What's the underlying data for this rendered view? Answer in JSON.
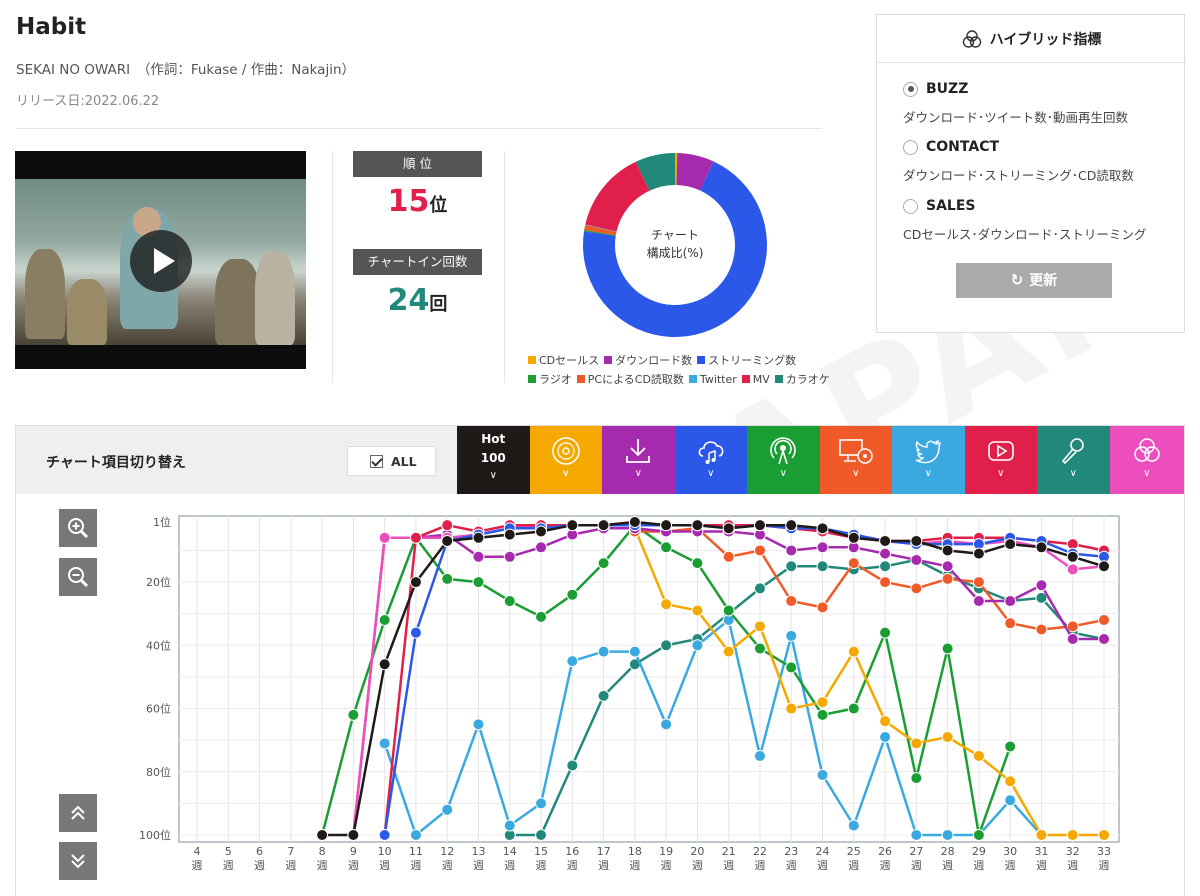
{
  "song": {
    "title": "Habit",
    "credit": "SEKAI NO OWARI　（作詞：Fukase / 作曲：Nakajin）",
    "release": "リリース日:2022.06.22"
  },
  "stats": {
    "rank_label": "順 位",
    "rank_value": "15",
    "rank_unit": "位",
    "chart_in_label": "チャートイン回数",
    "chart_in_value": "24",
    "chart_in_unit": "回"
  },
  "colors": {
    "cd": "#f5a800",
    "download": "#a52aad",
    "streaming": "#2b58e8",
    "radio": "#1a9e33",
    "pc": "#f05a28",
    "twitter": "#3aa9e0",
    "mv": "#e0204a",
    "karaoke": "#22897a",
    "hot100": "#1a1a1a",
    "hybrid": "#ec4fbd"
  },
  "composition": {
    "center_line1": "チャート",
    "center_line2": "構成比(%)",
    "segments": [
      {
        "name": "CDセールス",
        "value": 0.4,
        "color": "#f5a800"
      },
      {
        "name": "ダウンロード数",
        "value": 6.5,
        "color": "#a52aad"
      },
      {
        "name": "ストリーミング数",
        "value": 70.5,
        "color": "#2b58e8"
      },
      {
        "name": "ラジオ",
        "value": 0.2,
        "color": "#1a9e33"
      },
      {
        "name": "PCによるCD読取数",
        "value": 0.9,
        "color": "#f05a28"
      },
      {
        "name": "Twitter",
        "value": 0.1,
        "color": "#3aa9e0"
      },
      {
        "name": "MV",
        "value": 14.4,
        "color": "#e0204a"
      },
      {
        "name": "カラオケ",
        "value": 7.0,
        "color": "#22897a"
      }
    ]
  },
  "hybrid": {
    "title": "ハイブリッド指標",
    "options": [
      {
        "label": "BUZZ",
        "desc": "ダウンロード･ツイート数･動画再生回数",
        "selected": true
      },
      {
        "label": "CONTACT",
        "desc": "ダウンロード･ストリーミング･CD読取数",
        "selected": false
      },
      {
        "label": "SALES",
        "desc": "CDセールス･ダウンロード･ストリーミング",
        "selected": false
      }
    ],
    "update_label": "更新"
  },
  "toolbar": {
    "label": "チャート項目切り替え",
    "all_label": "ALL",
    "hot_line1": "Hot",
    "hot_line2": "100",
    "tabs": [
      {
        "name": "hot100",
        "color": "#1f1a17",
        "icon": "hot100-text"
      },
      {
        "name": "cd",
        "color": "#f5a800",
        "icon": "disc-icon"
      },
      {
        "name": "download",
        "color": "#a52aad",
        "icon": "download-icon"
      },
      {
        "name": "streaming",
        "color": "#2b58e8",
        "icon": "cloud-music-icon"
      },
      {
        "name": "radio",
        "color": "#1a9e33",
        "icon": "radio-icon"
      },
      {
        "name": "pc",
        "color": "#f05a28",
        "icon": "pc-disc-icon"
      },
      {
        "name": "twitter",
        "color": "#3aa9e0",
        "icon": "twitter-icon"
      },
      {
        "name": "mv",
        "color": "#e0204a",
        "icon": "video-icon"
      },
      {
        "name": "karaoke",
        "color": "#22897a",
        "icon": "microphone-icon"
      },
      {
        "name": "hybrid",
        "color": "#ec4fbd",
        "icon": "hybrid-icon"
      }
    ]
  },
  "chart_data": {
    "type": "line",
    "y_inverted": true,
    "ylim": [
      1,
      100
    ],
    "y_ticks": [
      "1位",
      "20位",
      "40位",
      "60位",
      "80位",
      "100位"
    ],
    "y_tick_values": [
      1,
      20,
      40,
      60,
      80,
      100
    ],
    "x": [
      4,
      5,
      6,
      7,
      8,
      9,
      10,
      11,
      12,
      13,
      14,
      15,
      16,
      17,
      18,
      19,
      20,
      21,
      22,
      23,
      24,
      25,
      26,
      27,
      28,
      29,
      30,
      31,
      32,
      33
    ],
    "x_labels_top": [
      "4",
      "5",
      "6",
      "7",
      "8",
      "9",
      "10",
      "11",
      "12",
      "13",
      "14",
      "15",
      "16",
      "17",
      "18",
      "19",
      "20",
      "21",
      "22",
      "23",
      "24",
      "25",
      "26",
      "27",
      "28",
      "29",
      "30",
      "31",
      "32",
      "33"
    ],
    "x_label_unit": "週",
    "grid": true,
    "series": [
      {
        "key": "karaoke",
        "color": "#22897a",
        "values": [
          null,
          null,
          null,
          null,
          null,
          null,
          null,
          null,
          null,
          null,
          100,
          100,
          78,
          56,
          46,
          40,
          38,
          30,
          22,
          15,
          15,
          16,
          15,
          13,
          18,
          22,
          26,
          25,
          36,
          38
        ]
      },
      {
        "key": "twitter",
        "color": "#3aa9e0",
        "values": [
          null,
          null,
          null,
          null,
          null,
          null,
          71,
          100,
          92,
          65,
          97,
          90,
          45,
          42,
          42,
          65,
          40,
          32,
          75,
          37,
          81,
          97,
          69,
          100,
          100,
          100,
          89,
          100,
          null,
          null
        ]
      },
      {
        "key": "radio",
        "color": "#1a9e33",
        "values": [
          null,
          null,
          null,
          null,
          100,
          62,
          32,
          6,
          19,
          20,
          26,
          31,
          24,
          14,
          2,
          9,
          14,
          29,
          41,
          47,
          62,
          60,
          36,
          82,
          41,
          100,
          72,
          null,
          null,
          null
        ]
      },
      {
        "key": "cd",
        "color": "#f5a800",
        "values": [
          null,
          null,
          null,
          null,
          null,
          null,
          null,
          null,
          null,
          null,
          null,
          null,
          null,
          null,
          3,
          27,
          29,
          42,
          34,
          60,
          58,
          42,
          64,
          71,
          69,
          75,
          83,
          100,
          100,
          100
        ]
      },
      {
        "key": "pc",
        "color": "#f05a28",
        "values": [
          null,
          null,
          null,
          null,
          null,
          null,
          null,
          null,
          null,
          null,
          null,
          null,
          null,
          null,
          4,
          4,
          3,
          12,
          10,
          26,
          28,
          14,
          20,
          22,
          19,
          20,
          33,
          35,
          34,
          32
        ]
      },
      {
        "key": "download",
        "color": "#a52aad",
        "values": [
          null,
          null,
          null,
          null,
          null,
          100,
          6,
          6,
          5,
          12,
          12,
          9,
          5,
          3,
          3,
          4,
          4,
          4,
          5,
          10,
          9,
          9,
          11,
          13,
          15,
          26,
          26,
          21,
          38,
          38
        ]
      },
      {
        "key": "hybrid",
        "color": "#ec4fbd",
        "values": [
          null,
          null,
          null,
          null,
          null,
          100,
          6,
          6,
          6,
          5,
          3,
          2,
          2,
          2,
          2,
          2,
          2,
          2,
          2,
          3,
          3,
          5,
          7,
          8,
          7,
          8,
          7,
          9,
          16,
          15
        ]
      },
      {
        "key": "mv",
        "color": "#e0204a",
        "values": [
          null,
          null,
          null,
          null,
          null,
          null,
          100,
          6,
          2,
          4,
          2,
          2,
          2,
          2,
          1,
          2,
          2,
          2,
          2,
          3,
          4,
          6,
          7,
          7,
          6,
          6,
          6,
          7,
          8,
          10
        ]
      },
      {
        "key": "streaming",
        "color": "#2b58e8",
        "values": [
          null,
          null,
          null,
          null,
          null,
          null,
          100,
          36,
          7,
          5,
          3,
          3,
          2,
          2,
          2,
          2,
          2,
          3,
          2,
          3,
          3,
          5,
          7,
          8,
          8,
          8,
          6,
          7,
          11,
          12
        ]
      },
      {
        "key": "hot100",
        "color": "#1f1a17",
        "values": [
          null,
          null,
          null,
          null,
          100,
          100,
          46,
          20,
          7,
          6,
          5,
          4,
          2,
          2,
          1,
          2,
          2,
          3,
          2,
          2,
          3,
          6,
          7,
          7,
          10,
          11,
          8,
          9,
          12,
          15
        ]
      }
    ]
  }
}
